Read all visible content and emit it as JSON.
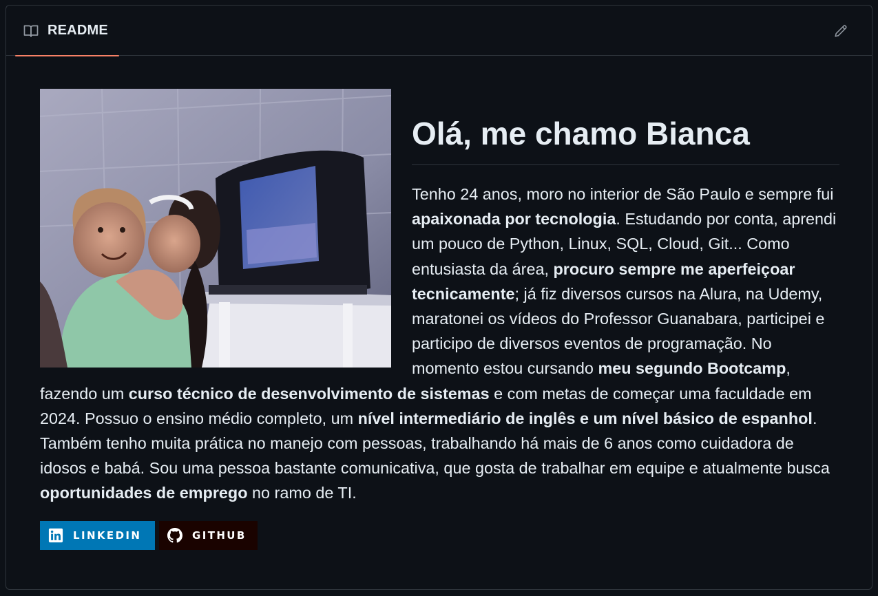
{
  "readme_tab": {
    "label": "README",
    "icon": "book-icon",
    "active_color": "#f78166"
  },
  "edit_button": {
    "icon": "pencil-icon"
  },
  "profile": {
    "title": "Olá, me chamo Bianca",
    "bio": [
      {
        "text": "Tenho 24 anos, moro no interior de São Paulo e sempre fui "
      },
      {
        "text": "apaixonada por tecnologia",
        "bold": true
      },
      {
        "text": ". Estudando por conta, aprendi um pouco de Python, Linux, SQL, Cloud, Git... Como entusiasta da área, "
      },
      {
        "text": "procuro sempre me aperfeiçoar tecnicamente",
        "bold": true
      },
      {
        "text": "; já fiz diversos cursos na Alura, na Udemy, maratonei os vídeos do Professor Guanabara, participei e participo de diversos eventos de programação. No momento estou cursando "
      },
      {
        "text": "meu segundo Bootcamp",
        "bold": true
      },
      {
        "text": ", fazendo um "
      },
      {
        "text": "curso técnico de desenvolvimento de sistemas",
        "bold": true
      },
      {
        "text": " e com metas de começar uma faculdade em 2024. Possuo o ensino médio completo, um "
      },
      {
        "text": "nível intermediário de inglês e um nível básico de espanhol",
        "bold": true
      },
      {
        "text": ". Também tenho muita prática no manejo com pessoas, trabalhando há mais de 6 anos como cuidadora de idosos e babá. Sou uma pessoa bastante comunicativa, que gosta de trabalhar em equipe e atualmente busca "
      },
      {
        "text": "oportunidades de emprego",
        "bold": true
      },
      {
        "text": " no ramo de TI."
      }
    ]
  },
  "badges": {
    "linkedin": {
      "label": "LINKEDIN",
      "icon": "linkedin-icon",
      "color": "#0077b5"
    },
    "github": {
      "label": "GITHUB",
      "icon": "github-icon",
      "color": "#1a0300"
    }
  }
}
